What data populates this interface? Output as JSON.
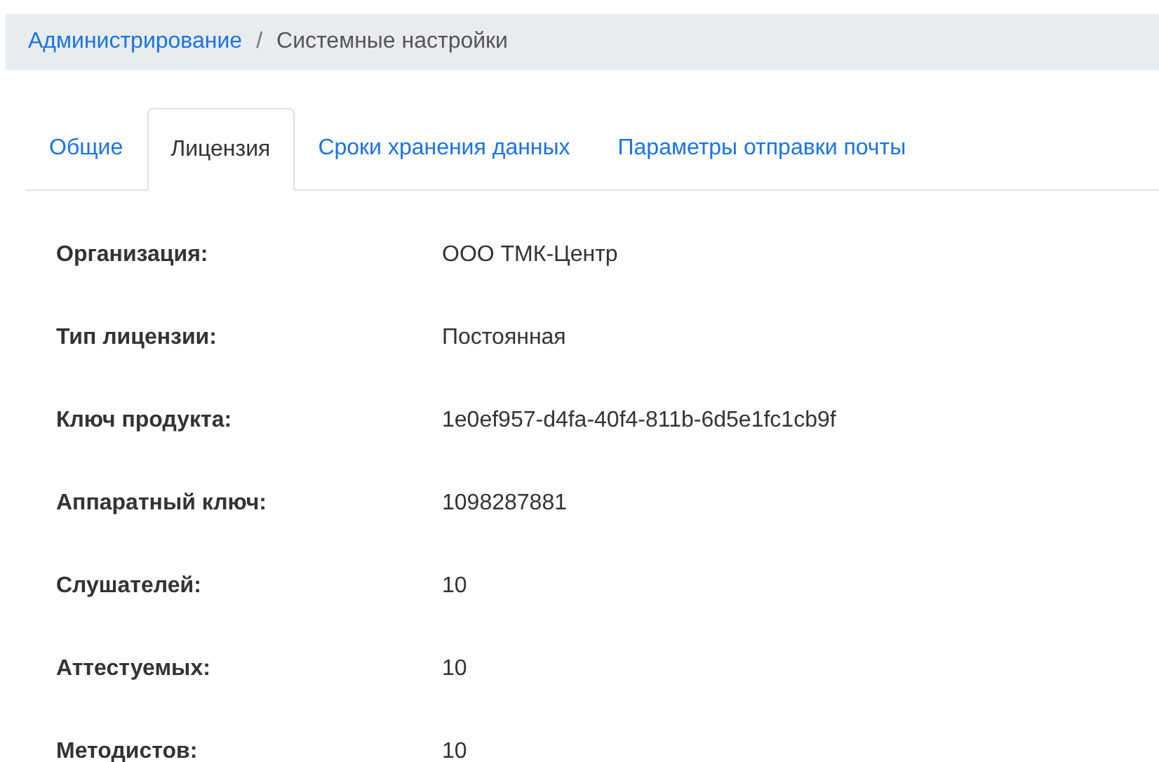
{
  "breadcrumb": {
    "link": "Администрирование",
    "separator": "/",
    "current": "Системные настройки"
  },
  "tabs": [
    {
      "label": "Общие",
      "selected": false
    },
    {
      "label": "Лицензия",
      "selected": true
    },
    {
      "label": "Сроки хранения данных",
      "selected": false
    },
    {
      "label": "Параметры отправки почты",
      "selected": false
    }
  ],
  "fields": [
    {
      "label": "Организация:",
      "value": "ООО ТМК-Центр"
    },
    {
      "label": "Тип лицензии:",
      "value": "Постоянная"
    },
    {
      "label": "Ключ продукта:",
      "value": "1e0ef957-d4fa-40f4-811b-6d5e1fc1cb9f"
    },
    {
      "label": "Аппаратный ключ:",
      "value": "1098287881"
    },
    {
      "label": "Слушателей:",
      "value": "10"
    },
    {
      "label": "Аттестуемых:",
      "value": "10"
    },
    {
      "label": "Методистов:",
      "value": "10"
    }
  ]
}
